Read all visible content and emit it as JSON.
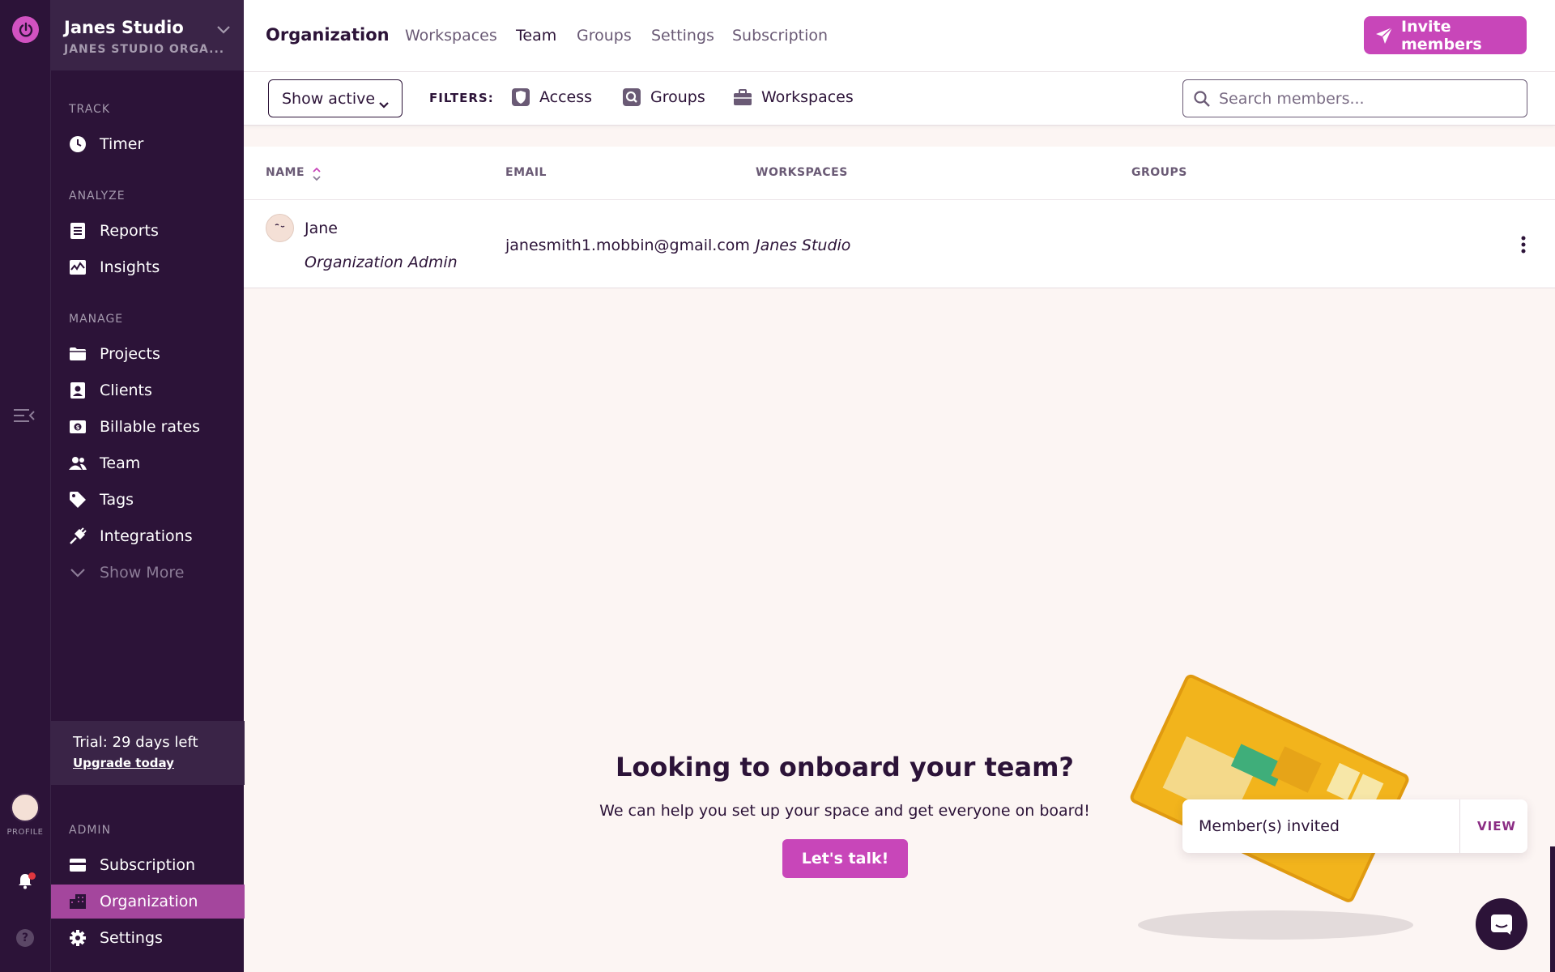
{
  "workspace": {
    "name": "Janes Studio",
    "subtitle": "JANES STUDIO ORGA..."
  },
  "rail": {
    "profile_label": "PROFILE"
  },
  "sidebar": {
    "sections": {
      "track": "TRACK",
      "analyze": "ANALYZE",
      "manage": "MANAGE",
      "admin": "ADMIN"
    },
    "items": {
      "timer": "Timer",
      "reports": "Reports",
      "insights": "Insights",
      "projects": "Projects",
      "clients": "Clients",
      "billable_rates": "Billable rates",
      "team": "Team",
      "tags": "Tags",
      "integrations": "Integrations",
      "show_more": "Show More",
      "subscription": "Subscription",
      "organization": "Organization",
      "settings": "Settings"
    },
    "trial": {
      "text": "Trial: 29 days left",
      "link": "Upgrade today"
    }
  },
  "header": {
    "title": "Organization",
    "tabs": [
      "Workspaces",
      "Team",
      "Groups",
      "Settings",
      "Subscription"
    ],
    "active_tab": "Team",
    "invite_label": "Invite members"
  },
  "filters": {
    "status_select": "Show active",
    "label": "FILTERS:",
    "items": [
      "Access",
      "Groups",
      "Workspaces"
    ],
    "search_placeholder": "Search members..."
  },
  "table": {
    "columns": [
      "NAME",
      "EMAIL",
      "WORKSPACES",
      "GROUPS"
    ],
    "rows": [
      {
        "name": "Jane",
        "role": "Organization Admin",
        "email": "janesmith1.mobbin@gmail.com",
        "workspaces": "Janes Studio",
        "groups": ""
      }
    ]
  },
  "onboard": {
    "title": "Looking to onboard your team?",
    "subtitle": "We can help you set up your space and get everyone on board!",
    "button": "Let's talk!"
  },
  "toast": {
    "message": "Member(s) invited",
    "action": "VIEW"
  },
  "colors": {
    "brand": "#c846b9",
    "sidebar_bg": "#2c1338",
    "active_nav": "#a4469d",
    "page_bg": "#fcf5f3"
  }
}
